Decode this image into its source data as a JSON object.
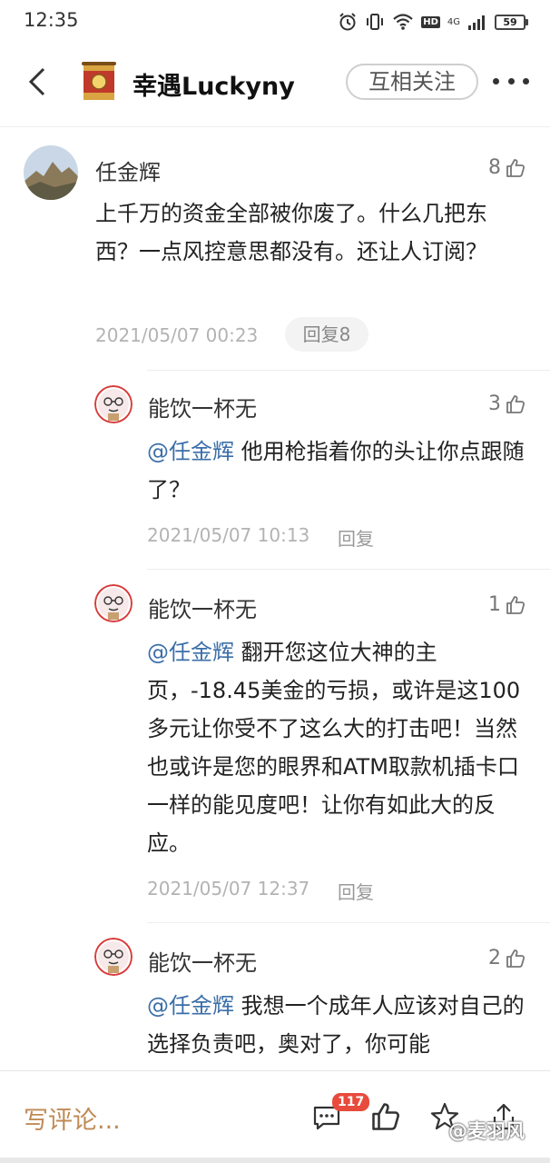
{
  "status_bar": {
    "time": "12:35",
    "hd": "HD",
    "network": "4G",
    "battery": "59",
    "icons": [
      "alarm-icon",
      "vibrate-icon",
      "wifi-icon",
      "signal-icon",
      "battery-icon"
    ]
  },
  "header": {
    "title": "幸遇Luckyny",
    "follow_label": "互相关注"
  },
  "main_comment": {
    "author": "任金辉",
    "likes": "8",
    "text": "上千万的资金全部被你废了。什么几把东西？一点风控意思都没有。还让人订阅？",
    "time": "2021/05/07 00:23",
    "reply_label": "回复8"
  },
  "replies": [
    {
      "author": "能饮一杯无",
      "likes": "3",
      "mention": "@任金辉",
      "text": " 他用枪指着你的头让你点跟随了？",
      "time": "2021/05/07 10:13",
      "reply_label": "回复"
    },
    {
      "author": "能饮一杯无",
      "likes": "1",
      "mention": "@任金辉",
      "text": " 翻开您这位大神的主页，-18.45美金的亏损，或许是这100多元让你受不了这么大的打击吧！当然也或许是您的眼界和ATM取款机插卡口一样的能见度吧！让你有如此大的反应。",
      "time": "2021/05/07 12:37",
      "reply_label": "回复"
    },
    {
      "author": "能饮一杯无",
      "likes": "2",
      "mention": "@任金辉",
      "text": " 我想一个成年人应该对自己的选择负责吧，奥对了，你可能",
      "time": "",
      "reply_label": ""
    }
  ],
  "bottom_bar": {
    "write_placeholder": "写评论...",
    "comment_count": "117",
    "watermark": "@麦羽风",
    "icons": [
      "comment-icon",
      "like-icon",
      "favorite-icon",
      "share-icon"
    ]
  },
  "colors": {
    "accent": "#bf8a55",
    "mention": "#3b6ea8",
    "badge": "#e84a3c"
  }
}
